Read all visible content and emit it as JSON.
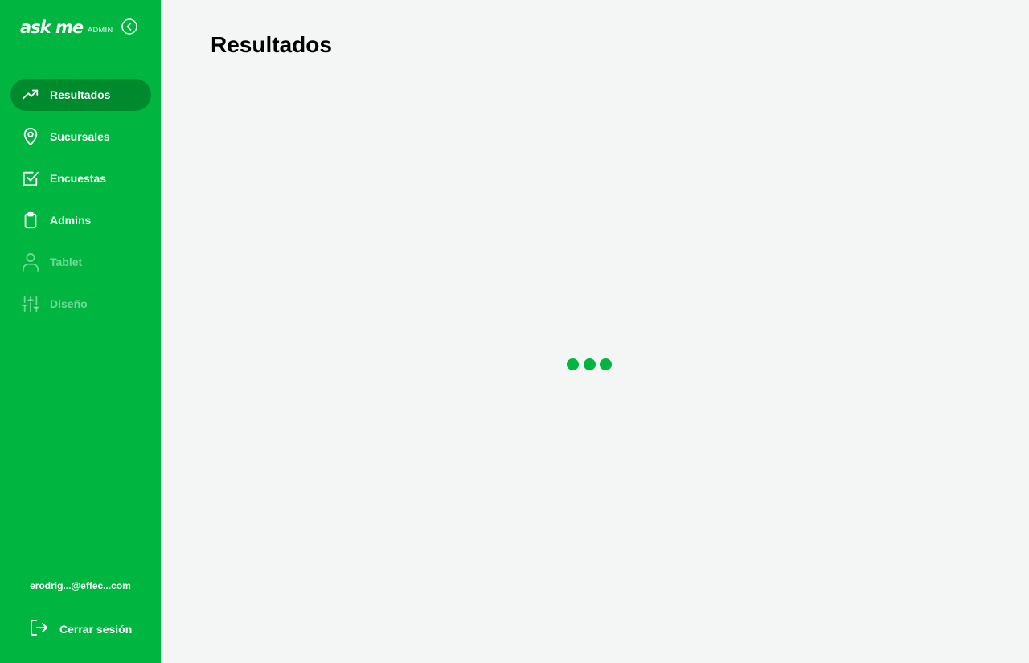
{
  "brand": {
    "logo_text": "ask me",
    "admin_tag": "ADMIN"
  },
  "sidebar": {
    "items": [
      {
        "label": "Resultados",
        "icon": "trending-up-icon",
        "active": true,
        "disabled": false
      },
      {
        "label": "Sucursales",
        "icon": "map-pin-icon",
        "active": false,
        "disabled": false
      },
      {
        "label": "Encuestas",
        "icon": "check-square-icon",
        "active": false,
        "disabled": false
      },
      {
        "label": "Admins",
        "icon": "clipboard-icon",
        "active": false,
        "disabled": false
      },
      {
        "label": "Tablet",
        "icon": "user-icon",
        "active": false,
        "disabled": true
      },
      {
        "label": "Diseño",
        "icon": "sliders-icon",
        "active": false,
        "disabled": true
      }
    ],
    "user_email": "erodrig...@effec...com",
    "logout_label": "Cerrar sesión"
  },
  "main": {
    "title": "Resultados",
    "loading": true
  },
  "colors": {
    "sidebar_bg": "#00b640",
    "active_item_bg": "#008a2e",
    "main_bg": "#f3f6f5",
    "loader_dot": "#00b640"
  }
}
